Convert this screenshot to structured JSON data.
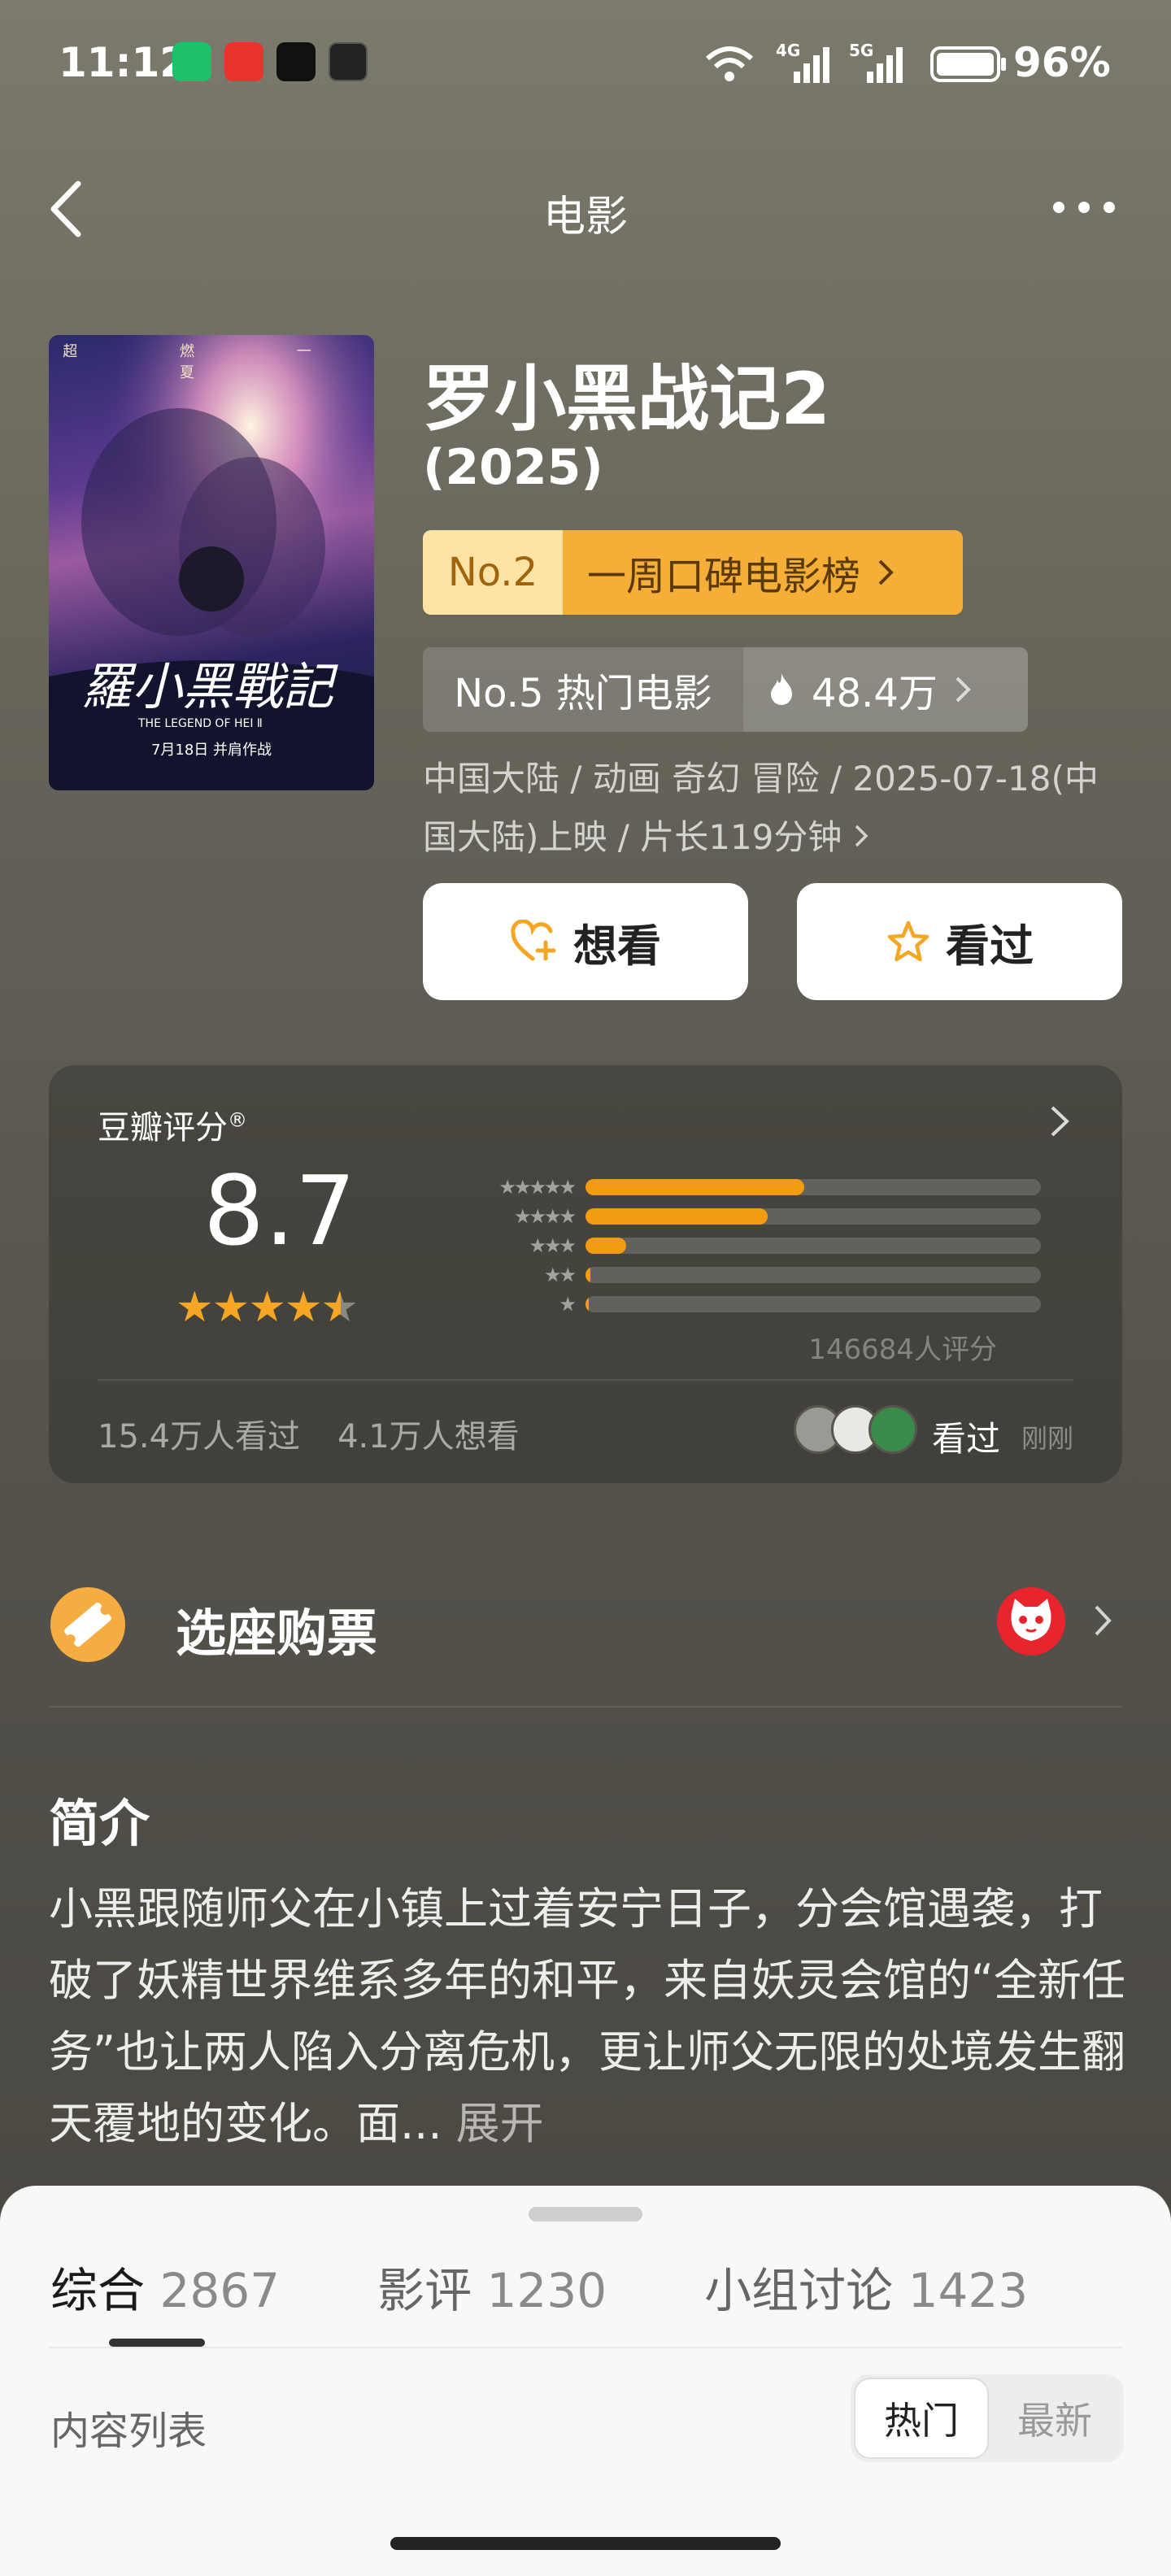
{
  "status_bar": {
    "time": "11:12",
    "net_4g": "4G",
    "net_5g": "5G",
    "battery": "96%"
  },
  "nav": {
    "title": "电影"
  },
  "movie": {
    "title": "罗小黑战记2",
    "year": "(2025)",
    "rank_weekly": {
      "no": "No.2",
      "label": "一周口碑电影榜"
    },
    "rank_hot": {
      "no": "No.5 热门电影",
      "heat": "48.4万"
    },
    "meta": "中国大陆 / 动画 奇幻 冒险 / 2025-07-18(中国大陆)上映 / 片长119分钟",
    "want_label": "想看",
    "seen_label": "看过",
    "poster_text": {
      "top": "超 燃 一 夏",
      "calligraphy": "羅小黑戰記",
      "en": "THE LEGEND OF HEI Ⅱ",
      "date": "7月18日 并肩作战"
    }
  },
  "rating": {
    "label": "豆瓣评分",
    "reg": "®",
    "score": "8.7",
    "stars": "★★★★★",
    "distribution": [
      0.48,
      0.4,
      0.09,
      0.01,
      0.005
    ],
    "count": "146684人评分",
    "seen_count": "15.4万人看过",
    "want_count": "4.1万人想看",
    "friends_seen": "看过",
    "friends_time": "刚刚"
  },
  "ticket": {
    "label": "选座购票"
  },
  "intro": {
    "heading": "简介",
    "text": "小黑跟随师父在小镇上过着安宁日子，分会馆遇袭，打破了妖精世界维系多年的和平，来自妖灵会馆的“全新任务”也让两人陷入分离危机，更让师父无限的处境发生翻天覆地的变化。面...",
    "more": "展开"
  },
  "sheet": {
    "tabs": [
      {
        "label": "综合",
        "count": "2867"
      },
      {
        "label": "影评",
        "count": "1230"
      },
      {
        "label": "小组讨论",
        "count": "1423"
      }
    ],
    "content_list": "内容列表",
    "sort_hot": "热门",
    "sort_new": "最新"
  },
  "colors": {
    "accent": "#f39c12",
    "weekly_rank_bg": "#f5ae38",
    "cat_red": "#e8242d"
  }
}
